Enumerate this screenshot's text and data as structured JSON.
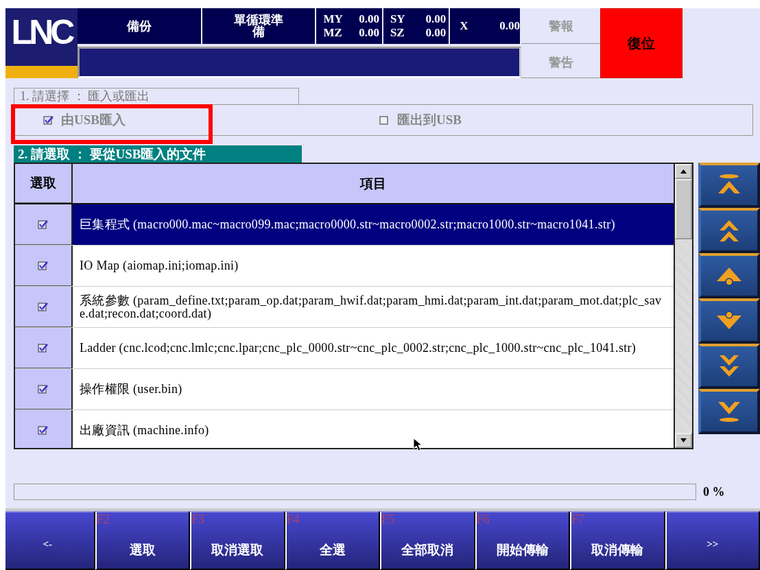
{
  "header": {
    "logo": "LNC",
    "status_cells": [
      {
        "kind": "text",
        "label": "備份"
      },
      {
        "kind": "text",
        "label": "單循環準備"
      }
    ],
    "axes": [
      {
        "rows": [
          {
            "name": "MY",
            "value": "0.00"
          },
          {
            "name": "MZ",
            "value": "0.00"
          }
        ]
      },
      {
        "rows": [
          {
            "name": "SY",
            "value": "0.00"
          },
          {
            "name": "SZ",
            "value": "0.00"
          }
        ]
      },
      {
        "rows": [
          {
            "name": "X",
            "value": "0.00"
          }
        ]
      }
    ],
    "alarm": "警報",
    "warning": "警告",
    "reset": "復位"
  },
  "section_1": {
    "title": "1. 請選擇 ： 匯入或匯出",
    "options": [
      {
        "label": "由USB匯入",
        "checked": true
      },
      {
        "label": "匯出到USB",
        "checked": false
      }
    ]
  },
  "section_2": {
    "title": "2. 請選取 ： 要從USB匯入的文件"
  },
  "table": {
    "columns": [
      "選取",
      "項目"
    ],
    "rows": [
      {
        "checked": true,
        "selected": true,
        "item": "巨集程式 (macro000.mac~macro099.mac;macro0000.str~macro0002.str;macro1000.str~macro1041.str)"
      },
      {
        "checked": true,
        "selected": false,
        "item": "IO Map (aiomap.ini;iomap.ini)"
      },
      {
        "checked": true,
        "selected": false,
        "item": "系統參數 (param_define.txt;param_op.dat;param_hwif.dat;param_hmi.dat;param_int.dat;param_mot.dat;plc_save.dat;recon.dat;coord.dat)"
      },
      {
        "checked": true,
        "selected": false,
        "item": "Ladder (cnc.lcod;cnc.lmlc;cnc.lpar;cnc_plc_0000.str~cnc_plc_0002.str;cnc_plc_1000.str~cnc_plc_1041.str)"
      },
      {
        "checked": true,
        "selected": false,
        "item": "操作權限 (user.bin)"
      },
      {
        "checked": true,
        "selected": false,
        "item": "出廠資訊 (machine.info)"
      }
    ]
  },
  "nav_buttons": [
    {
      "kind": "top"
    },
    {
      "kind": "page-up"
    },
    {
      "kind": "up"
    },
    {
      "kind": "down"
    },
    {
      "kind": "page-down"
    },
    {
      "kind": "bottom"
    }
  ],
  "progress": {
    "level": 0,
    "reading": "0 %"
  },
  "function_keys": [
    {
      "label": "<-"
    },
    {
      "key": "F2",
      "label": "選取"
    },
    {
      "key": "F3",
      "label": "取消選取"
    },
    {
      "key": "F4",
      "label": "全選"
    },
    {
      "key": "F5",
      "label": "全部取消"
    },
    {
      "key": "F6",
      "label": "開始傳輸"
    },
    {
      "key": "F7",
      "label": "取消傳輸"
    },
    {
      "label": ">>"
    }
  ]
}
